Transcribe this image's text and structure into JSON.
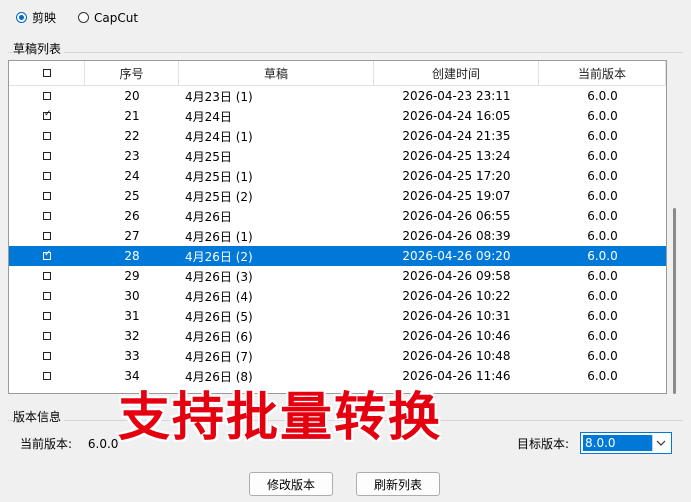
{
  "radio": {
    "options": [
      {
        "label": "剪映",
        "checked": true
      },
      {
        "label": "CapCut",
        "checked": false
      }
    ]
  },
  "drafts": {
    "group_label": "草稿列表",
    "columns": [
      "",
      "序号",
      "草稿",
      "创建时间",
      "当前版本"
    ],
    "selected_index": 8,
    "rows": [
      {
        "checked": false,
        "no": "20",
        "name": "4月23日 (1)",
        "created": "2026-04-23 23:11",
        "version": "6.0.0"
      },
      {
        "checked": true,
        "no": "21",
        "name": "4月24日",
        "created": "2026-04-24 16:05",
        "version": "6.0.0"
      },
      {
        "checked": false,
        "no": "22",
        "name": "4月24日 (1)",
        "created": "2026-04-24 21:35",
        "version": "6.0.0"
      },
      {
        "checked": false,
        "no": "23",
        "name": "4月25日",
        "created": "2026-04-25 13:24",
        "version": "6.0.0"
      },
      {
        "checked": false,
        "no": "24",
        "name": "4月25日 (1)",
        "created": "2026-04-25 17:20",
        "version": "6.0.0"
      },
      {
        "checked": false,
        "no": "25",
        "name": "4月25日 (2)",
        "created": "2026-04-25 19:07",
        "version": "6.0.0"
      },
      {
        "checked": false,
        "no": "26",
        "name": "4月26日",
        "created": "2026-04-26 06:55",
        "version": "6.0.0"
      },
      {
        "checked": false,
        "no": "27",
        "name": "4月26日 (1)",
        "created": "2026-04-26 08:39",
        "version": "6.0.0"
      },
      {
        "checked": true,
        "no": "28",
        "name": "4月26日 (2)",
        "created": "2026-04-26 09:20",
        "version": "6.0.0"
      },
      {
        "checked": false,
        "no": "29",
        "name": "4月26日 (3)",
        "created": "2026-04-26 09:58",
        "version": "6.0.0"
      },
      {
        "checked": false,
        "no": "30",
        "name": "4月26日 (4)",
        "created": "2026-04-26 10:22",
        "version": "6.0.0"
      },
      {
        "checked": false,
        "no": "31",
        "name": "4月26日 (5)",
        "created": "2026-04-26 10:31",
        "version": "6.0.0"
      },
      {
        "checked": false,
        "no": "32",
        "name": "4月26日 (6)",
        "created": "2026-04-26 10:46",
        "version": "6.0.0"
      },
      {
        "checked": false,
        "no": "33",
        "name": "4月26日 (7)",
        "created": "2026-04-26 10:48",
        "version": "6.0.0"
      },
      {
        "checked": false,
        "no": "34",
        "name": "4月26日 (8)",
        "created": "2026-04-26 11:46",
        "version": "6.0.0"
      }
    ]
  },
  "version_info": {
    "group_label": "版本信息",
    "current_label": "当前版本:",
    "current_value": "6.0.0",
    "target_label": "目标版本:",
    "target_value": "8.0.0"
  },
  "overlay_caption": "支持批量转换",
  "buttons": {
    "modify": "修改版本",
    "refresh": "刷新列表"
  },
  "colors": {
    "accent": "#0078d7",
    "caption": "#e50010"
  }
}
